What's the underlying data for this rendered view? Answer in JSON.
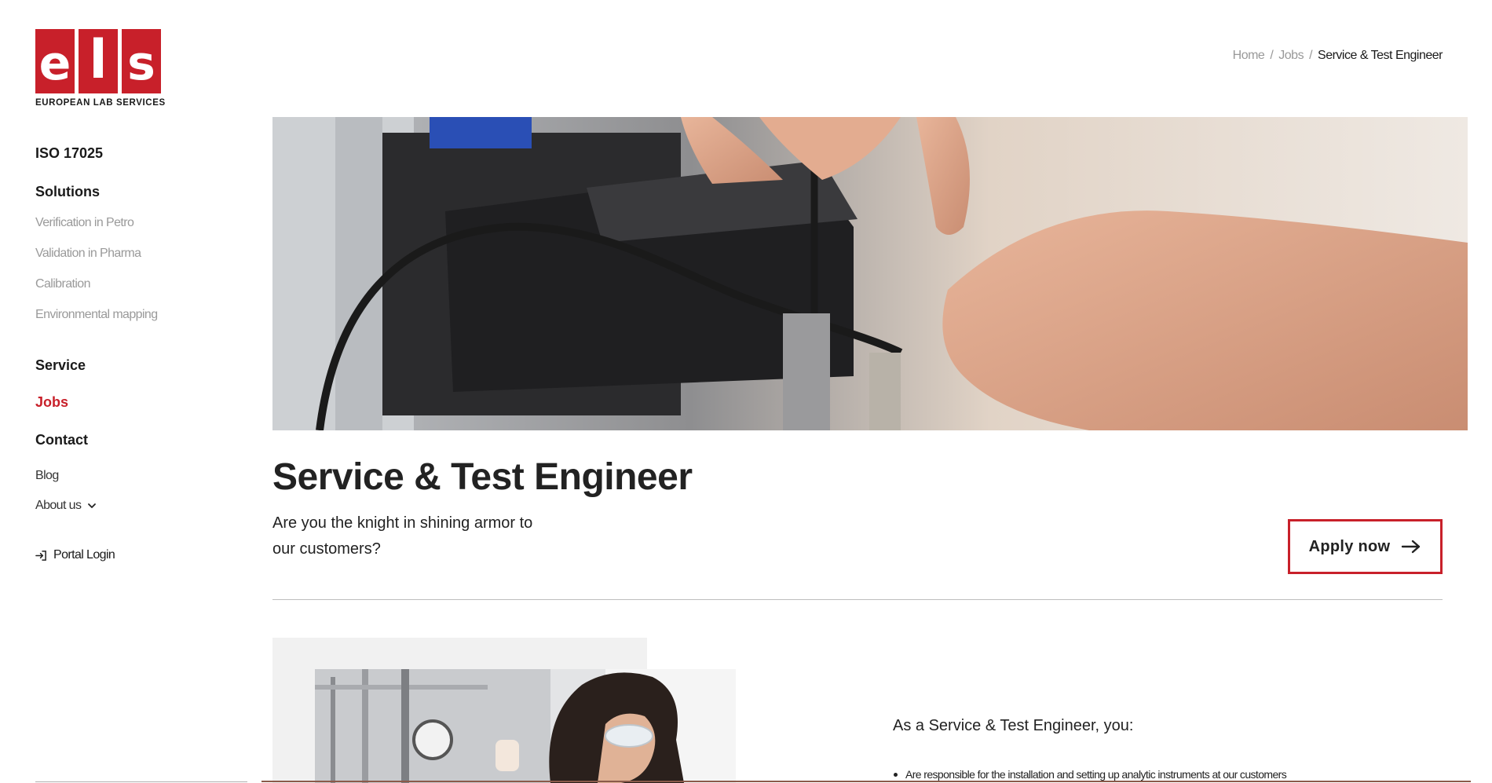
{
  "logo": {
    "letters": [
      "e",
      "l",
      "s"
    ],
    "subtitle": "EUROPEAN LAB SERVICES",
    "color": "#c8202a"
  },
  "nav": {
    "iso": "ISO 17025",
    "solutions": "Solutions",
    "solutions_items": [
      "Verification in Petro",
      "Validation in Pharma",
      "Calibration",
      "Environmental mapping"
    ],
    "service": "Service",
    "jobs": "Jobs",
    "contact": "Contact",
    "blog": "Blog",
    "about": "About us",
    "portal": "Portal Login"
  },
  "breadcrumb": {
    "home": "Home",
    "jobs": "Jobs",
    "current": "Service & Test Engineer"
  },
  "job": {
    "title": "Service & Test Engineer",
    "subtitle": "Are you the knight in shining armor to our customers?",
    "apply_label": "Apply now",
    "intro": "As a Service & Test Engineer, you:",
    "responsibilities": [
      "Are responsible for the installation and setting up analytic instruments at our customers"
    ]
  },
  "colors": {
    "accent": "#c8202a",
    "text": "#222222",
    "muted": "#999999"
  }
}
